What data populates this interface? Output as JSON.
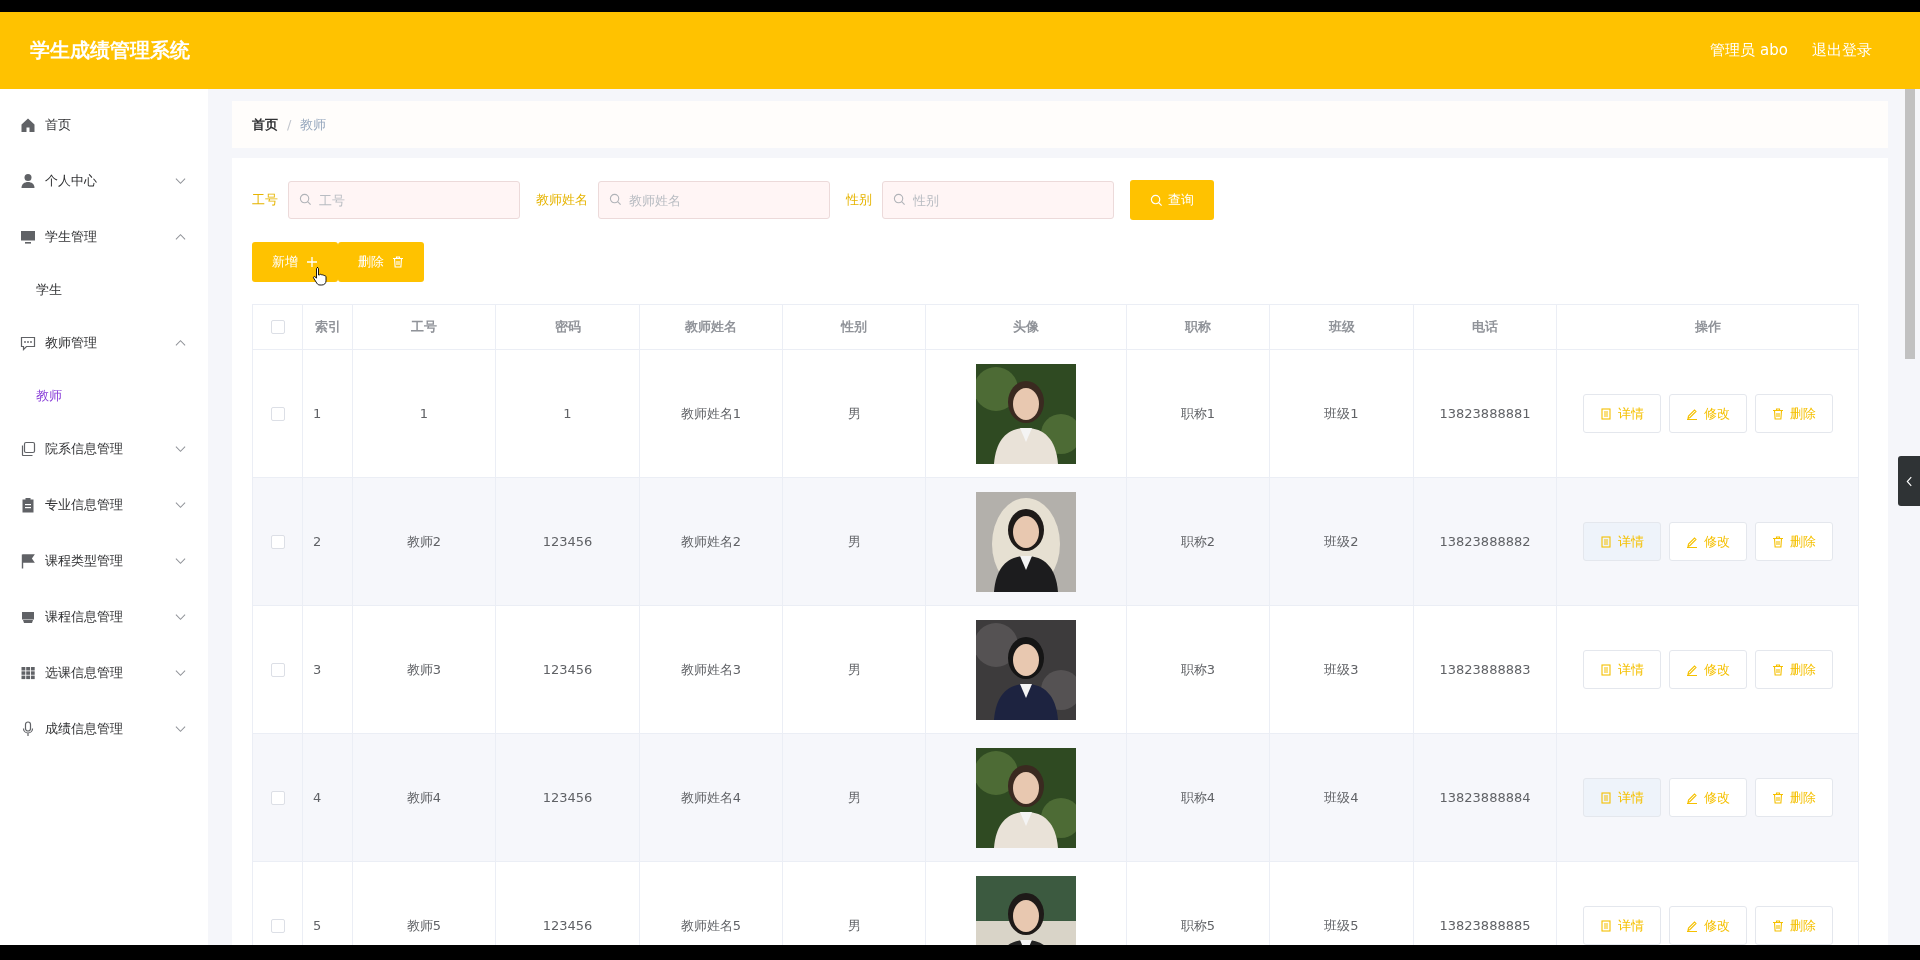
{
  "header": {
    "title": "学生成绩管理系统",
    "user": "管理员 abo",
    "logout": "退出登录"
  },
  "sidebar": {
    "items": [
      {
        "label": "首页"
      },
      {
        "label": "个人中心",
        "expanded": false
      },
      {
        "label": "学生管理",
        "expanded": true,
        "children": [
          {
            "label": "学生",
            "selected": false
          }
        ]
      },
      {
        "label": "教师管理",
        "expanded": true,
        "children": [
          {
            "label": "教师",
            "selected": true
          }
        ]
      },
      {
        "label": "院系信息管理",
        "expanded": false
      },
      {
        "label": "专业信息管理",
        "expanded": false
      },
      {
        "label": "课程类型管理",
        "expanded": false
      },
      {
        "label": "课程信息管理",
        "expanded": false
      },
      {
        "label": "选课信息管理",
        "expanded": false
      },
      {
        "label": "成绩信息管理",
        "expanded": false
      }
    ]
  },
  "breadcrumb": {
    "items": [
      "首页",
      "教师"
    ],
    "separator": "/"
  },
  "filters": [
    {
      "label": "工号",
      "placeholder": "工号"
    },
    {
      "label": "教师姓名",
      "placeholder": "教师姓名"
    },
    {
      "label": "性别",
      "placeholder": "性别"
    }
  ],
  "search_button": "查询",
  "toolbar": [
    "新增",
    "删除"
  ],
  "table": {
    "header_checked": false,
    "columns": [
      "索引",
      "工号",
      "密码",
      "教师姓名",
      "性别",
      "头像",
      "职称",
      "班级",
      "电话",
      "操作"
    ],
    "rows": [
      {
        "checked": false,
        "cells": [
          "1",
          "1",
          "1",
          "教师姓名1",
          "男"
        ],
        "cells2": [
          "职称1",
          "班级1",
          "13823888881"
        ],
        "actions": [
          "详情",
          "修改",
          "删除"
        ]
      },
      {
        "checked": false,
        "cells": [
          "2",
          "教师2",
          "123456",
          "教师姓名2",
          "男"
        ],
        "cells2": [
          "职称2",
          "班级2",
          "13823888882"
        ],
        "actions": [
          "详情",
          "修改",
          "删除"
        ]
      },
      {
        "checked": false,
        "cells": [
          "3",
          "教师3",
          "123456",
          "教师姓名3",
          "男"
        ],
        "cells2": [
          "职称3",
          "班级3",
          "13823888883"
        ],
        "actions": [
          "详情",
          "修改",
          "删除"
        ]
      },
      {
        "checked": false,
        "cells": [
          "4",
          "教师4",
          "123456",
          "教师姓名4",
          "男"
        ],
        "cells2": [
          "职称4",
          "班级4",
          "13823888884"
        ],
        "actions": [
          "详情",
          "修改",
          "删除"
        ]
      },
      {
        "checked": false,
        "cells": [
          "5",
          "教师5",
          "123456",
          "教师姓名5",
          "男"
        ],
        "cells2": [
          "职称5",
          "班级5",
          "13823888885"
        ],
        "actions": [
          "详情",
          "修改",
          "删除"
        ]
      }
    ]
  }
}
